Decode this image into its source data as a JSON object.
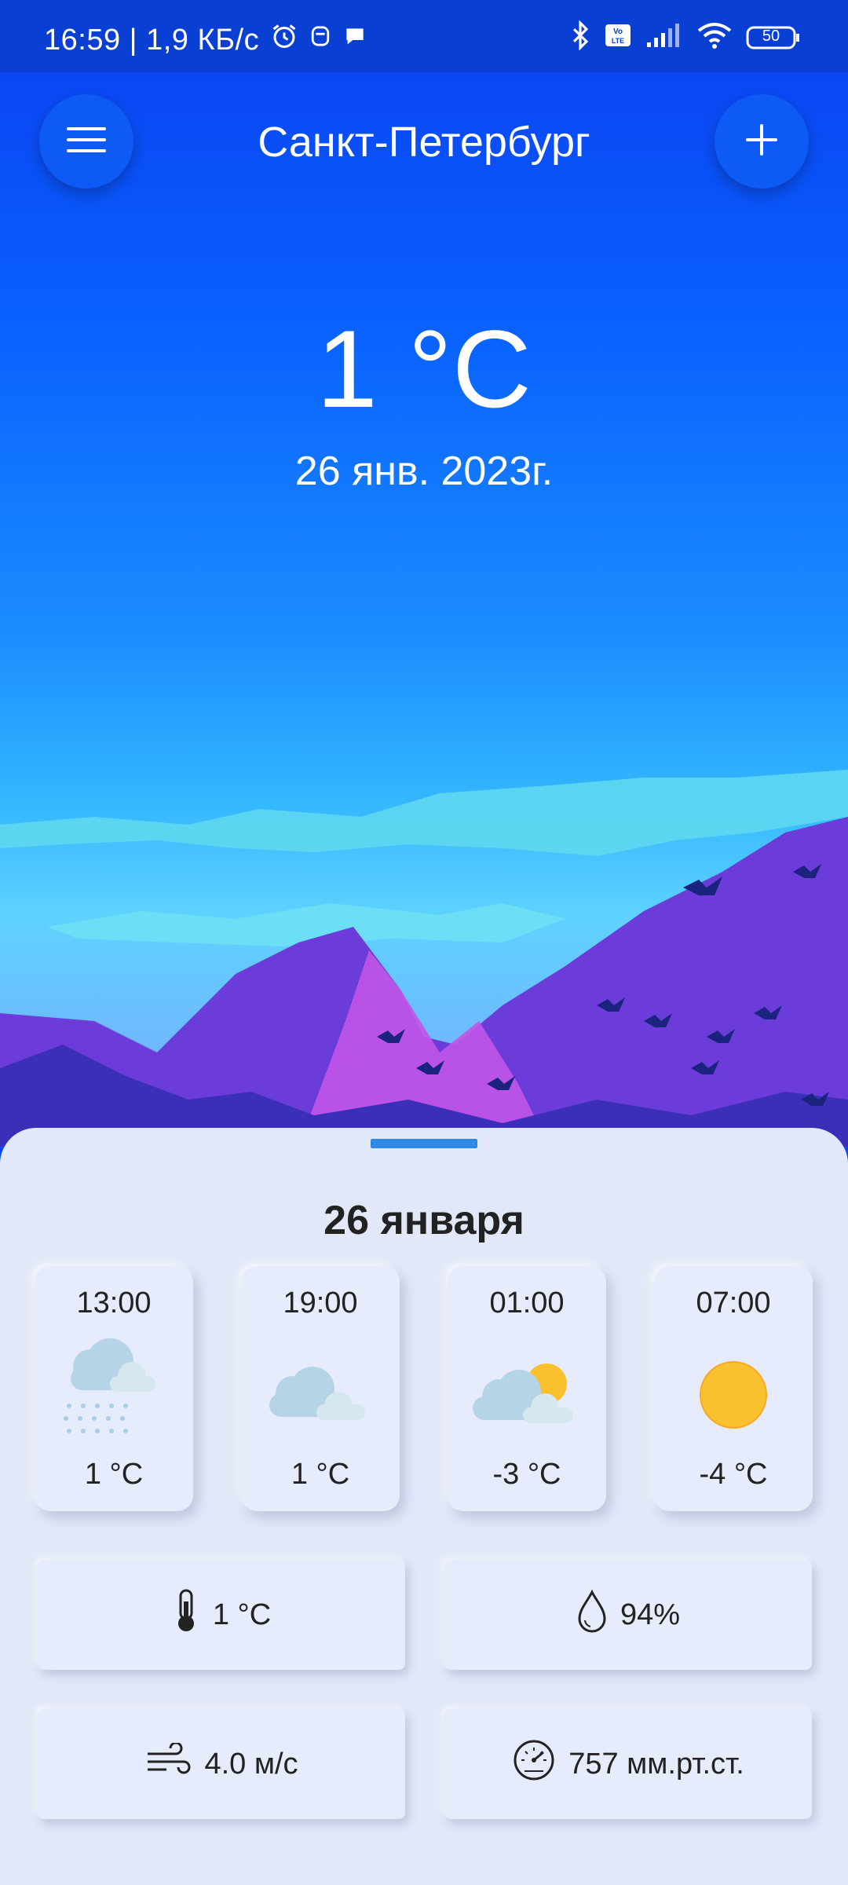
{
  "status_bar": {
    "time_speed": "16:59 | 1,9 КБ/с",
    "battery": "50",
    "icons": [
      "alarm-icon",
      "notification-icon",
      "chat-icon",
      "bluetooth-icon",
      "volte-icon",
      "signal-icon",
      "wifi-icon",
      "battery-icon"
    ]
  },
  "header": {
    "city": "Санкт-Петербург",
    "menu_icon": "menu-icon",
    "add_icon": "plus-icon"
  },
  "current": {
    "temperature": "1 °C",
    "date": "26 янв. 2023г."
  },
  "sheet": {
    "title": "26 января",
    "hourly": [
      {
        "time": "13:00",
        "temp": "1 °C",
        "icon": "cloud-snow-icon"
      },
      {
        "time": "19:00",
        "temp": "1 °C",
        "icon": "cloud-icon"
      },
      {
        "time": "01:00",
        "temp": "-3 °C",
        "icon": "partly-cloudy-icon"
      },
      {
        "time": "07:00",
        "temp": "-4 °C",
        "icon": "sun-icon"
      }
    ],
    "stats": {
      "temperature": "1 °C",
      "humidity": "94%",
      "wind": "4.0 м/с",
      "pressure": "757 мм.рт.ст."
    }
  },
  "colors": {
    "accent": "#2d8be6",
    "sky_top": "#0a3ff0",
    "sheet_bg": "#e2e8f8"
  }
}
